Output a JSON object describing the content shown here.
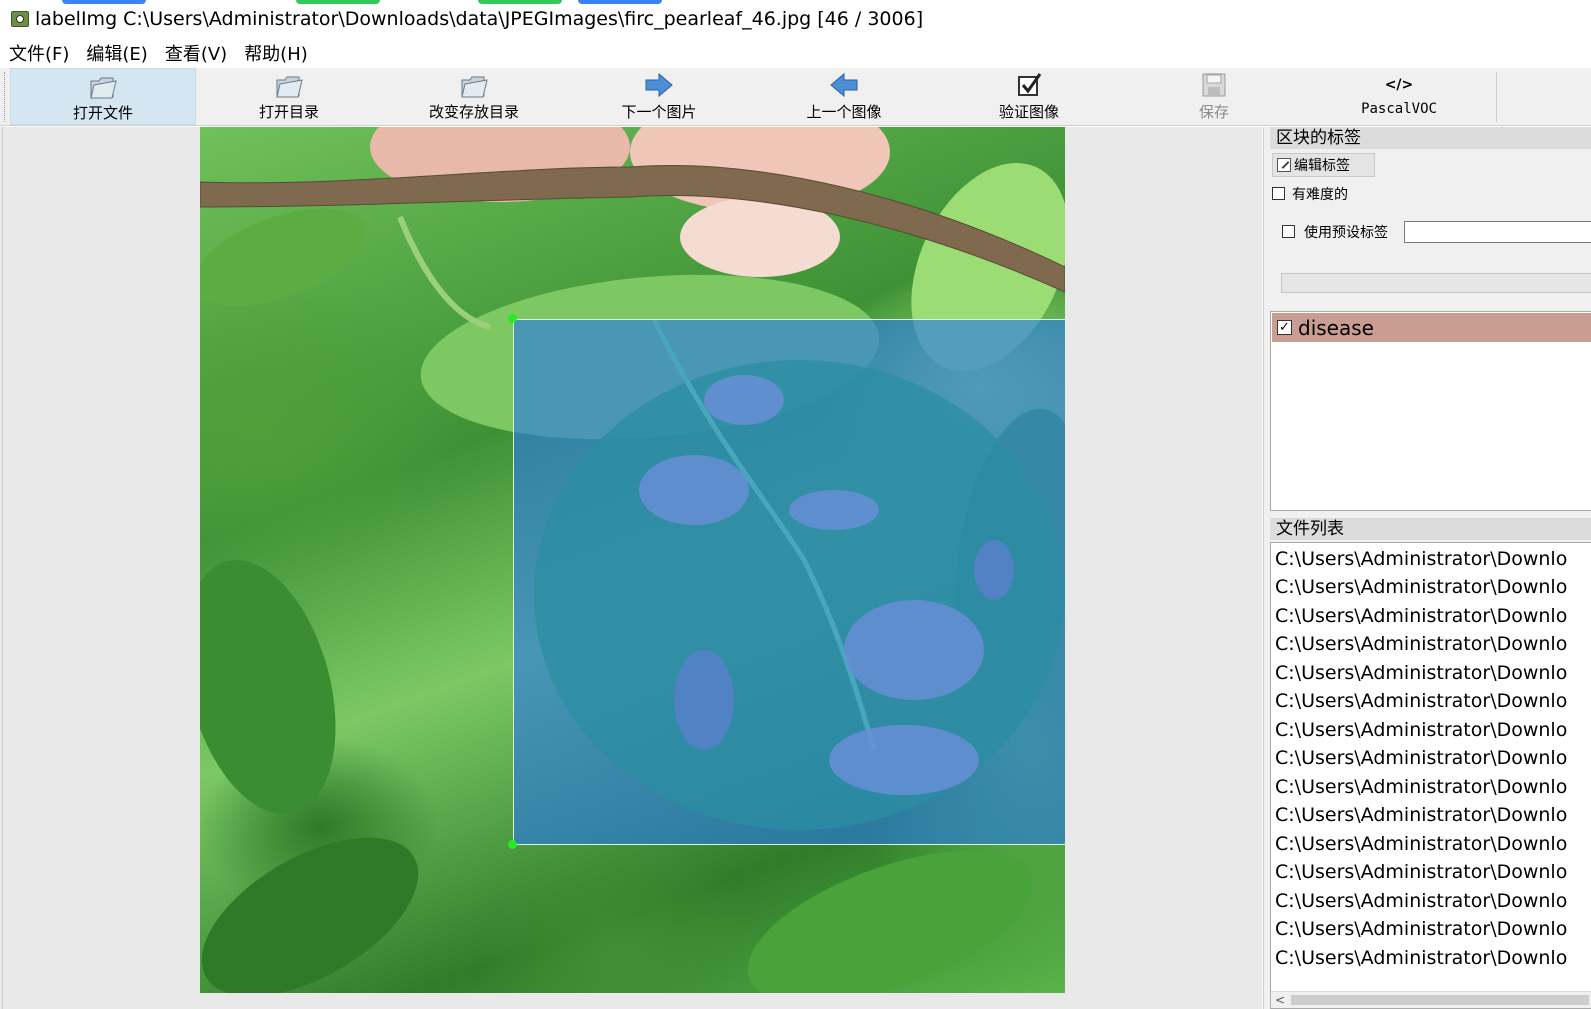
{
  "window": {
    "title": "labelImg C:\\Users\\Administrator\\Downloads\\data\\JPEGImages\\firc_pearleaf_46.jpg [46 / 3006]"
  },
  "menu": [
    "文件(F)",
    "编辑(E)",
    "查看(V)",
    "帮助(H)"
  ],
  "toolbar": {
    "open_file": "打开文件",
    "open_dir": "打开目录",
    "change_save_dir": "改变存放目录",
    "next_image": "下一个图片",
    "prev_image": "上一个图像",
    "verify_image": "验证图像",
    "save": "保存",
    "format": "PascalVOC",
    "format_icon_text": "</>"
  },
  "box_labels_panel": {
    "title": "区块的标签",
    "edit_label_button": "编辑标签",
    "difficult_checkbox": "有难度的",
    "use_default_label_checkbox": "使用预设标签",
    "default_label_value": "",
    "labels": [
      {
        "text": "disease",
        "checked": true
      }
    ]
  },
  "file_list_panel": {
    "title": "文件列表",
    "items": [
      "C:\\Users\\Administrator\\Downlo",
      "C:\\Users\\Administrator\\Downlo",
      "C:\\Users\\Administrator\\Downlo",
      "C:\\Users\\Administrator\\Downlo",
      "C:\\Users\\Administrator\\Downlo",
      "C:\\Users\\Administrator\\Downlo",
      "C:\\Users\\Administrator\\Downlo",
      "C:\\Users\\Administrator\\Downlo",
      "C:\\Users\\Administrator\\Downlo",
      "C:\\Users\\Administrator\\Downlo",
      "C:\\Users\\Administrator\\Downlo",
      "C:\\Users\\Administrator\\Downlo",
      "C:\\Users\\Administrator\\Downlo",
      "C:\\Users\\Administrator\\Downlo",
      "C:\\Users\\Administrator\\Downlo"
    ]
  },
  "colors": {
    "bbox_fill": "#2878e6",
    "bbox_corner": "#22ee22",
    "label_row_bg": "#c99d91",
    "toolbar_active": "#d5e6f3"
  }
}
